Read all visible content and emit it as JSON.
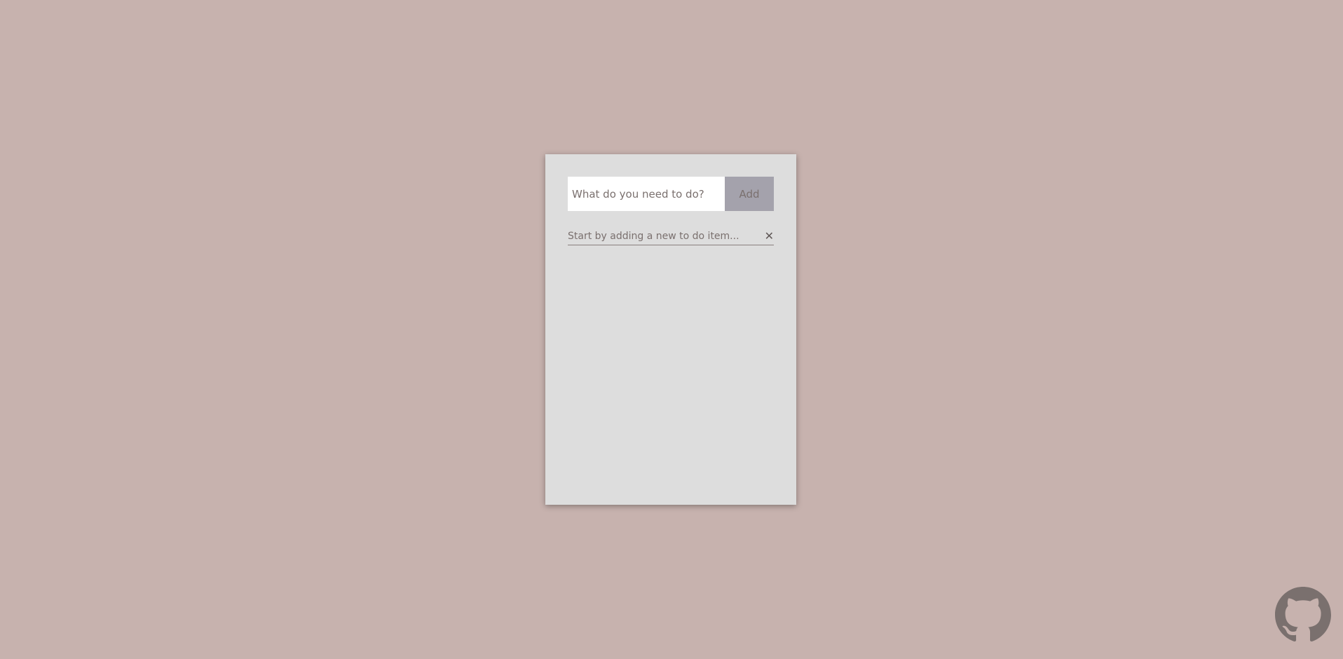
{
  "todo_form": {
    "input_placeholder": "What do you need to do?",
    "input_value": "",
    "add_label": "Add"
  },
  "todo_list": {
    "items": [
      {
        "text": "Start by adding a new to do item...",
        "remove_glyph": "✕"
      }
    ]
  },
  "footer": {
    "github_icon": "github-octocat-icon"
  },
  "colors": {
    "page_background": "#c7b2ae",
    "card_background": "#dddddd",
    "add_button_background": "#a4a2ac",
    "text": "#7a706e"
  }
}
